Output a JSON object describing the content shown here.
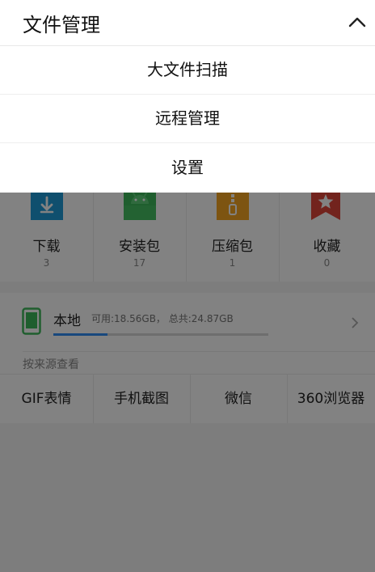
{
  "header": {
    "title": "文件管理",
    "collapse_icon": "chevron-up-icon"
  },
  "menu": {
    "items": [
      {
        "label": "大文件扫描"
      },
      {
        "label": "远程管理"
      },
      {
        "label": "设置"
      }
    ]
  },
  "categories": [
    {
      "label": "下载",
      "count": "3",
      "icon": "download-icon",
      "color": "#1f9bd7"
    },
    {
      "label": "安装包",
      "count": "17",
      "icon": "android-icon",
      "color": "#3db85a"
    },
    {
      "label": "压缩包",
      "count": "1",
      "icon": "zip-icon",
      "color": "#f5a623"
    },
    {
      "label": "收藏",
      "count": "0",
      "icon": "bookmark-star-icon",
      "color": "#e0463a"
    }
  ],
  "storage": {
    "title": "本地",
    "info": "可用:18.56GB， 总共:24.87GB",
    "used_fraction": 0.25,
    "icon": "phone-icon",
    "icon_color": "#3db85a",
    "bar_color": "#2f8df5"
  },
  "sources": {
    "label": "按来源查看",
    "items": [
      {
        "label": "GIF表情"
      },
      {
        "label": "手机截图"
      },
      {
        "label": "微信"
      },
      {
        "label": "360浏览器"
      }
    ]
  }
}
